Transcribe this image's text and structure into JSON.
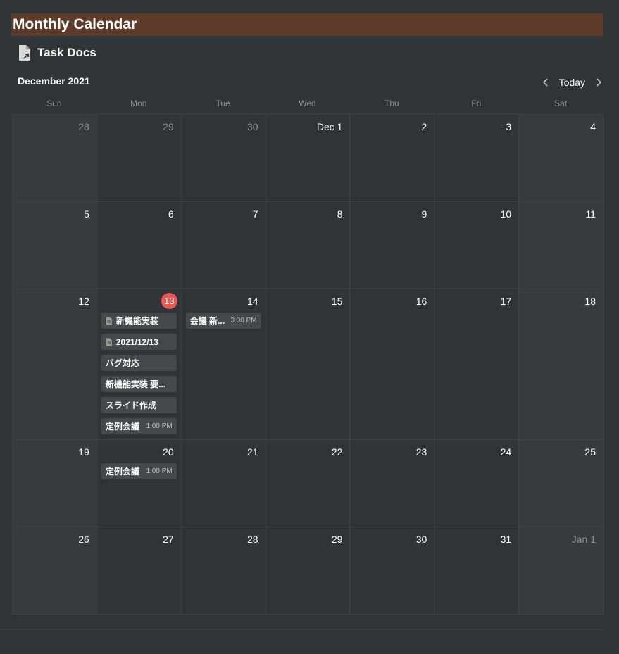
{
  "page_title": "Monthly Calendar",
  "database": {
    "title": "Task Docs",
    "icon": "document-icon"
  },
  "calendar": {
    "month_label": "December 2021",
    "today_label": "Today",
    "weekdays": [
      "Sun",
      "Mon",
      "Tue",
      "Wed",
      "Thu",
      "Fri",
      "Sat"
    ],
    "colors": {
      "accent_today": "#eb5757",
      "title_bar": "#5c3b28",
      "background": "#2f3437",
      "event_bg": "#44494c"
    },
    "weeks": [
      {
        "days": [
          {
            "label": "28",
            "muted": true,
            "events": []
          },
          {
            "label": "29",
            "muted": true,
            "events": []
          },
          {
            "label": "30",
            "muted": true,
            "events": []
          },
          {
            "label": "Dec 1",
            "events": []
          },
          {
            "label": "2",
            "events": []
          },
          {
            "label": "3",
            "events": []
          },
          {
            "label": "4",
            "events": []
          }
        ]
      },
      {
        "days": [
          {
            "label": "5",
            "events": []
          },
          {
            "label": "6",
            "events": []
          },
          {
            "label": "7",
            "events": []
          },
          {
            "label": "8",
            "events": []
          },
          {
            "label": "9",
            "events": []
          },
          {
            "label": "10",
            "events": []
          },
          {
            "label": "11",
            "events": []
          }
        ]
      },
      {
        "days": [
          {
            "label": "12",
            "events": []
          },
          {
            "label": "13",
            "today": true,
            "events": [
              {
                "title": "新機能実装",
                "icon": "page-icon"
              },
              {
                "title": "2021/12/13",
                "icon": "page-icon"
              },
              {
                "title": "バグ対応"
              },
              {
                "title": "新機能実装 要..."
              },
              {
                "title": "スライド作成"
              },
              {
                "title": "定例会議",
                "time": "1:00 PM"
              }
            ]
          },
          {
            "label": "14",
            "events": [
              {
                "title": "会議 新...",
                "time": "3:00 PM"
              }
            ]
          },
          {
            "label": "15",
            "events": []
          },
          {
            "label": "16",
            "events": []
          },
          {
            "label": "17",
            "events": []
          },
          {
            "label": "18",
            "events": []
          }
        ]
      },
      {
        "days": [
          {
            "label": "19",
            "events": []
          },
          {
            "label": "20",
            "events": [
              {
                "title": "定例会議",
                "time": "1:00 PM"
              }
            ]
          },
          {
            "label": "21",
            "events": []
          },
          {
            "label": "22",
            "events": []
          },
          {
            "label": "23",
            "events": []
          },
          {
            "label": "24",
            "events": []
          },
          {
            "label": "25",
            "events": []
          }
        ]
      },
      {
        "days": [
          {
            "label": "26",
            "events": []
          },
          {
            "label": "27",
            "events": []
          },
          {
            "label": "28",
            "events": []
          },
          {
            "label": "29",
            "events": []
          },
          {
            "label": "30",
            "events": []
          },
          {
            "label": "31",
            "events": []
          },
          {
            "label": "Jan 1",
            "muted": true,
            "events": []
          }
        ]
      }
    ]
  }
}
